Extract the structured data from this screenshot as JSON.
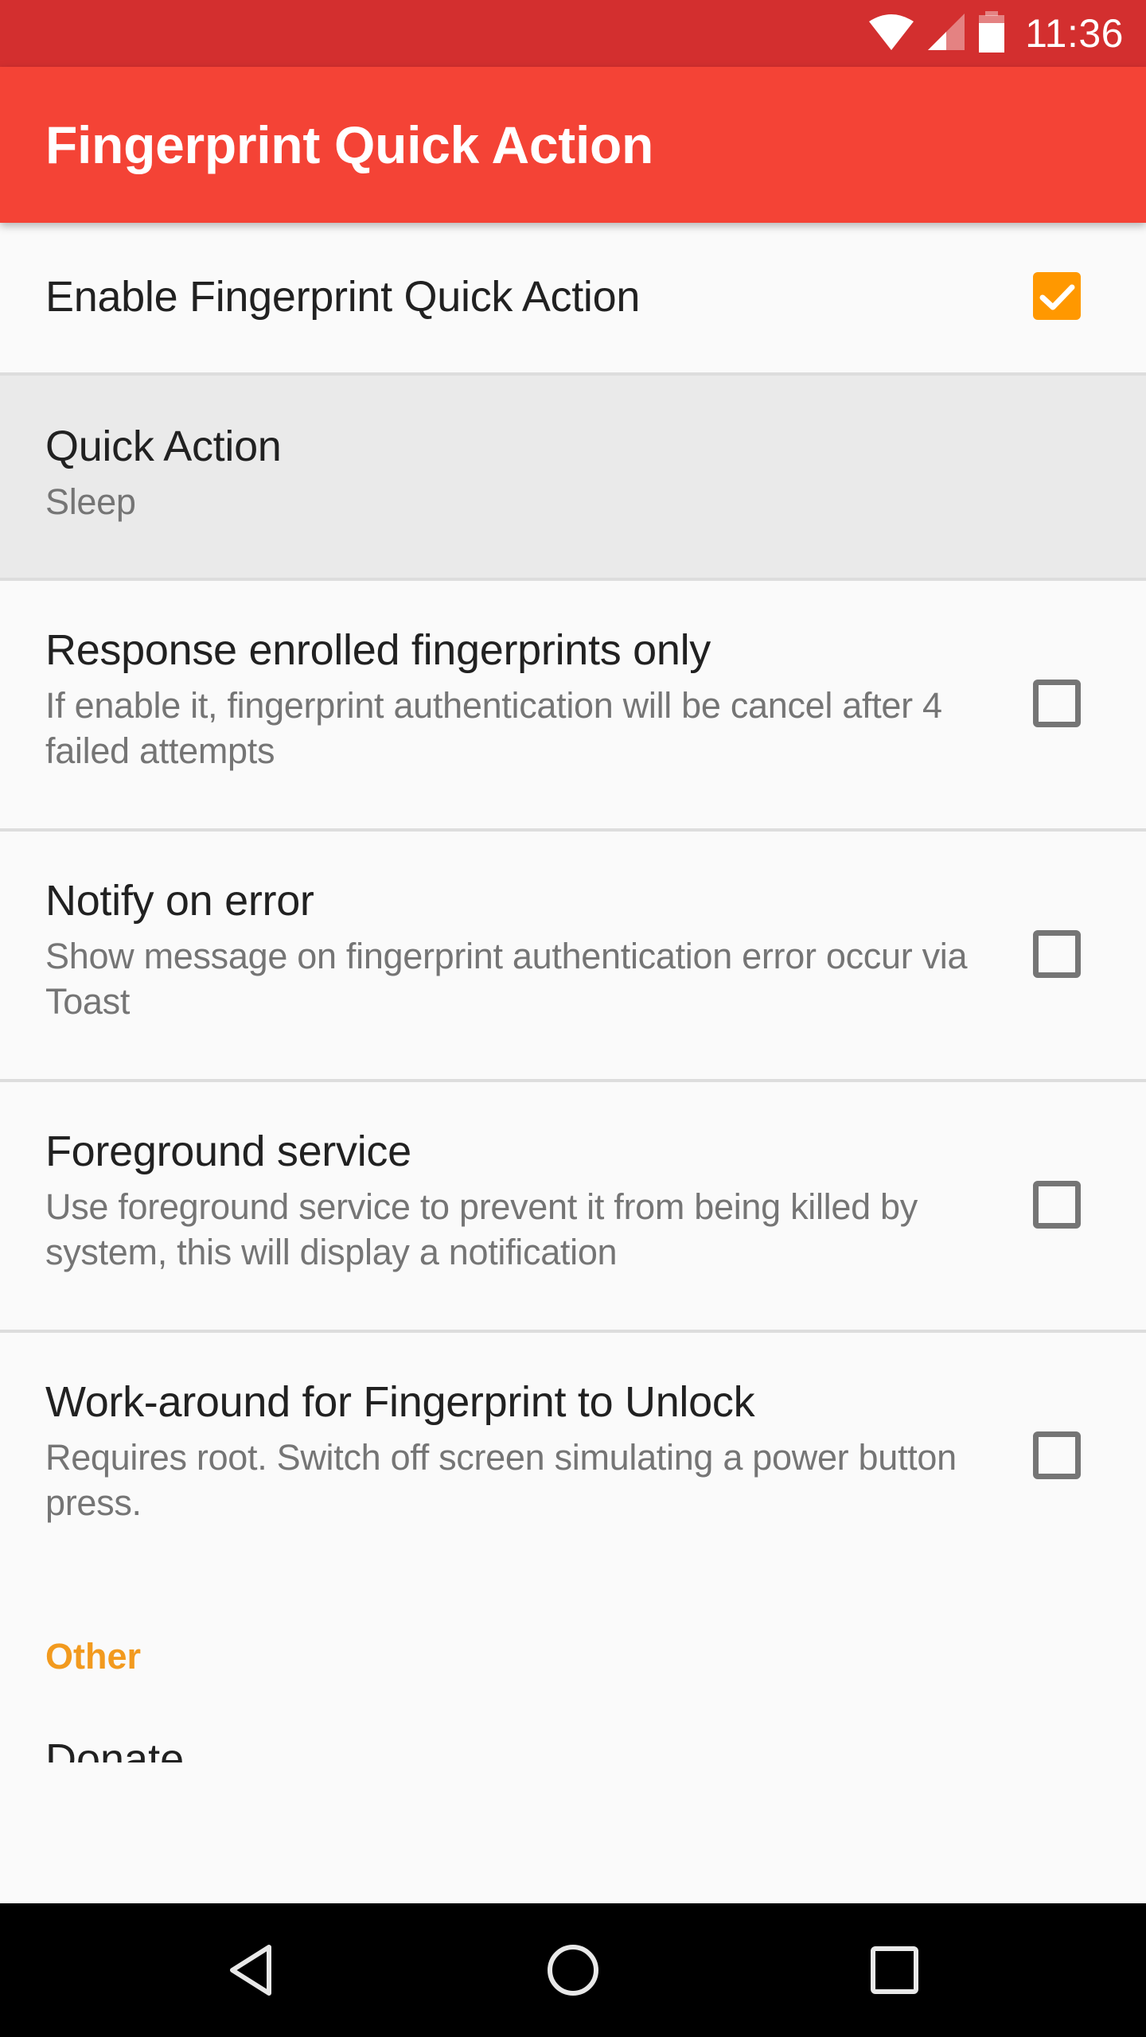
{
  "status_bar": {
    "time": "11:36",
    "icons": [
      "wifi-icon",
      "cell-signal-icon",
      "battery-icon"
    ]
  },
  "app_bar": {
    "title": "Fingerprint Quick Action"
  },
  "colors": {
    "status_bar": "#D32F2F",
    "primary": "#F44336",
    "accent": "#FF9800",
    "category_text": "#F29A1E"
  },
  "preferences": [
    {
      "title": "Enable Fingerprint Quick Action",
      "summary": null,
      "checkbox": true,
      "checked": true
    },
    {
      "title": "Quick Action",
      "summary": "Sleep",
      "checkbox": false,
      "pressed": true
    },
    {
      "title": "Response enrolled fingerprints only",
      "summary": "If enable it, fingerprint authentication will be cancel after 4 failed attempts",
      "checkbox": true,
      "checked": false
    },
    {
      "title": "Notify on error",
      "summary": "Show message on fingerprint authentication error occur via Toast",
      "checkbox": true,
      "checked": false
    },
    {
      "title": "Foreground service",
      "summary": "Use foreground service to prevent it from being killed by system, this will display a notification",
      "checkbox": true,
      "checked": false
    },
    {
      "title": "Work-around for Fingerprint to Unlock",
      "summary": "Requires root. Switch off screen simulating a power button press.",
      "checkbox": true,
      "checked": false
    }
  ],
  "other_category": {
    "label": "Other",
    "items": [
      {
        "title": "Donate"
      }
    ]
  },
  "nav_bar": {
    "buttons": [
      "back-icon",
      "home-icon",
      "recents-icon"
    ]
  }
}
